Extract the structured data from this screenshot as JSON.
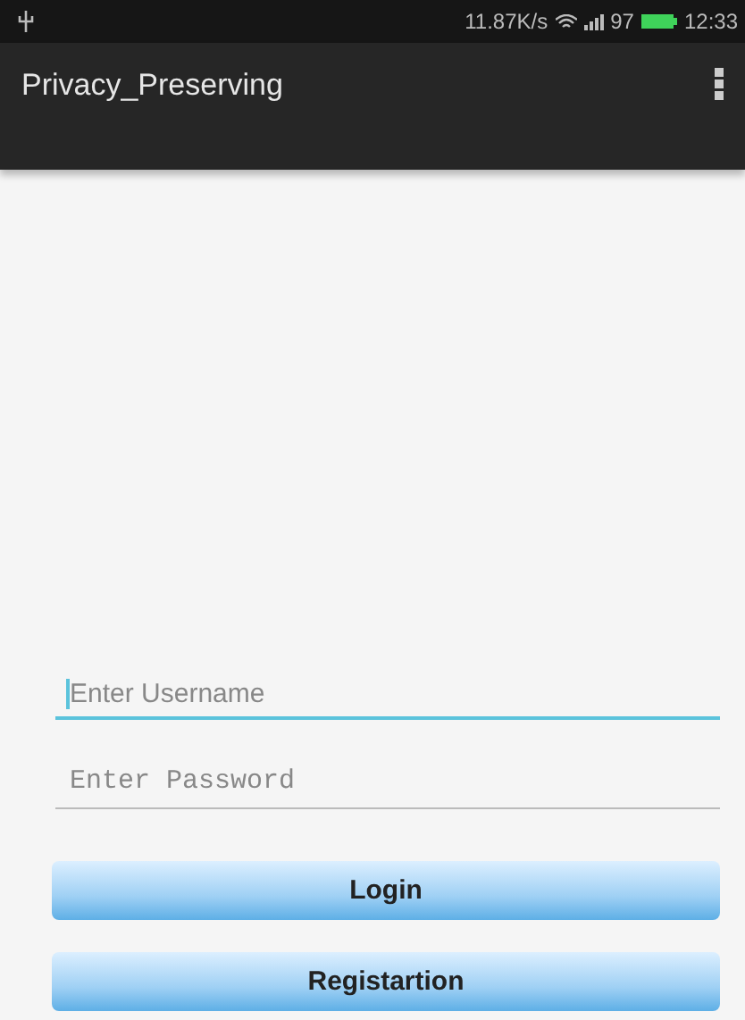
{
  "status_bar": {
    "speed": "11.87K/s",
    "battery": "97",
    "time": "12:33"
  },
  "app_bar": {
    "title": "Privacy_Preserving"
  },
  "fields": [
    {
      "placeholder": "Enter Username",
      "kind": "text",
      "focused": true
    },
    {
      "placeholder": "Enter Password",
      "kind": "password",
      "focused": false
    }
  ],
  "buttons": [
    "Login",
    "Registartion"
  ]
}
